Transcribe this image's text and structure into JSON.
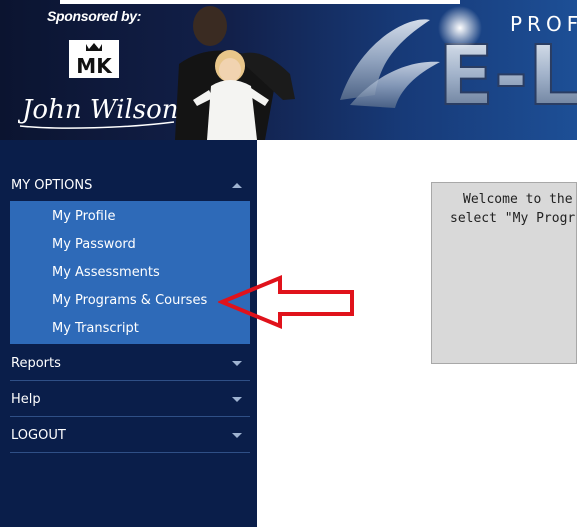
{
  "header": {
    "sponsor_text": "Sponsored by:",
    "logo_text": "MK",
    "signature_text": "John Wilson",
    "brand_partial": "PROF",
    "brand_letters": "E-L"
  },
  "sidebar": {
    "sections": [
      {
        "label": "MY OPTIONS",
        "expanded": true,
        "items": [
          {
            "label": "My Profile"
          },
          {
            "label": "My Password"
          },
          {
            "label": "My Assessments"
          },
          {
            "label": "My Programs & Courses",
            "highlighted_by_arrow": true
          },
          {
            "label": "My Transcript"
          }
        ]
      },
      {
        "label": "Reports",
        "expanded": false
      },
      {
        "label": "Help",
        "expanded": false
      },
      {
        "label": "LOGOUT",
        "expanded": false
      }
    ]
  },
  "main": {
    "welcome_line1": "Welcome to the",
    "welcome_line2": "select \"My Progra"
  },
  "colors": {
    "sidebar_bg": "#0a1e4a",
    "submenu_bg": "#2e6ab8",
    "arrow": "#e0121b",
    "welcome_box": "#d9d9d9"
  }
}
